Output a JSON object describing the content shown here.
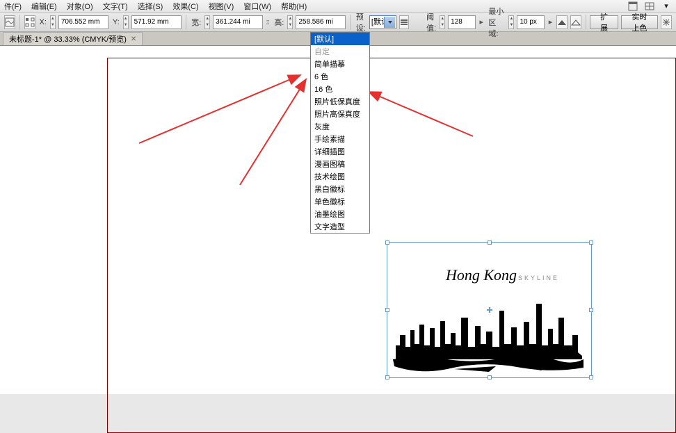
{
  "menu": {
    "file": "件(F)",
    "edit": "编辑(E)",
    "object": "对象(O)",
    "text": "文字(T)",
    "select": "选择(S)",
    "effect": "效果(C)",
    "view": "视图(V)",
    "window": "窗口(W)",
    "help": "帮助(H)"
  },
  "optionbar": {
    "x_label": "X:",
    "x_value": "706.552 mm",
    "y_label": "Y:",
    "y_value": "571.92 mm",
    "w_label": "宽:",
    "w_value": "361.244 mi",
    "h_label": "高:",
    "h_value": "258.586 mi",
    "preset_label": "预设:",
    "preset_value": "[默认]",
    "threshold_label": "阈值:",
    "threshold_value": "128",
    "minarea_label": "最小区域:",
    "minarea_value": "10 px",
    "btn_expand": "扩展",
    "btn_livepaint": "实时上色"
  },
  "tab": {
    "title": "未标题-1* @ 33.33% (CMYK/预览)"
  },
  "dropdown": {
    "items": [
      {
        "label": "[默认]",
        "selected": true
      },
      {
        "label": "自定",
        "disabled": true
      },
      {
        "label": "简单描摹"
      },
      {
        "label": "6 色"
      },
      {
        "label": "16 色"
      },
      {
        "label": "照片低保真度"
      },
      {
        "label": "照片高保真度"
      },
      {
        "label": "灰度"
      },
      {
        "label": "手绘素描"
      },
      {
        "label": "详细插图"
      },
      {
        "label": "漫画图稿"
      },
      {
        "label": "技术绘图"
      },
      {
        "label": "黑白徽标"
      },
      {
        "label": "单色徽标"
      },
      {
        "label": "油墨绘图"
      },
      {
        "label": "文字造型"
      }
    ]
  },
  "artwork": {
    "title": "Hong Kong",
    "subtitle": "SKYLINE"
  }
}
